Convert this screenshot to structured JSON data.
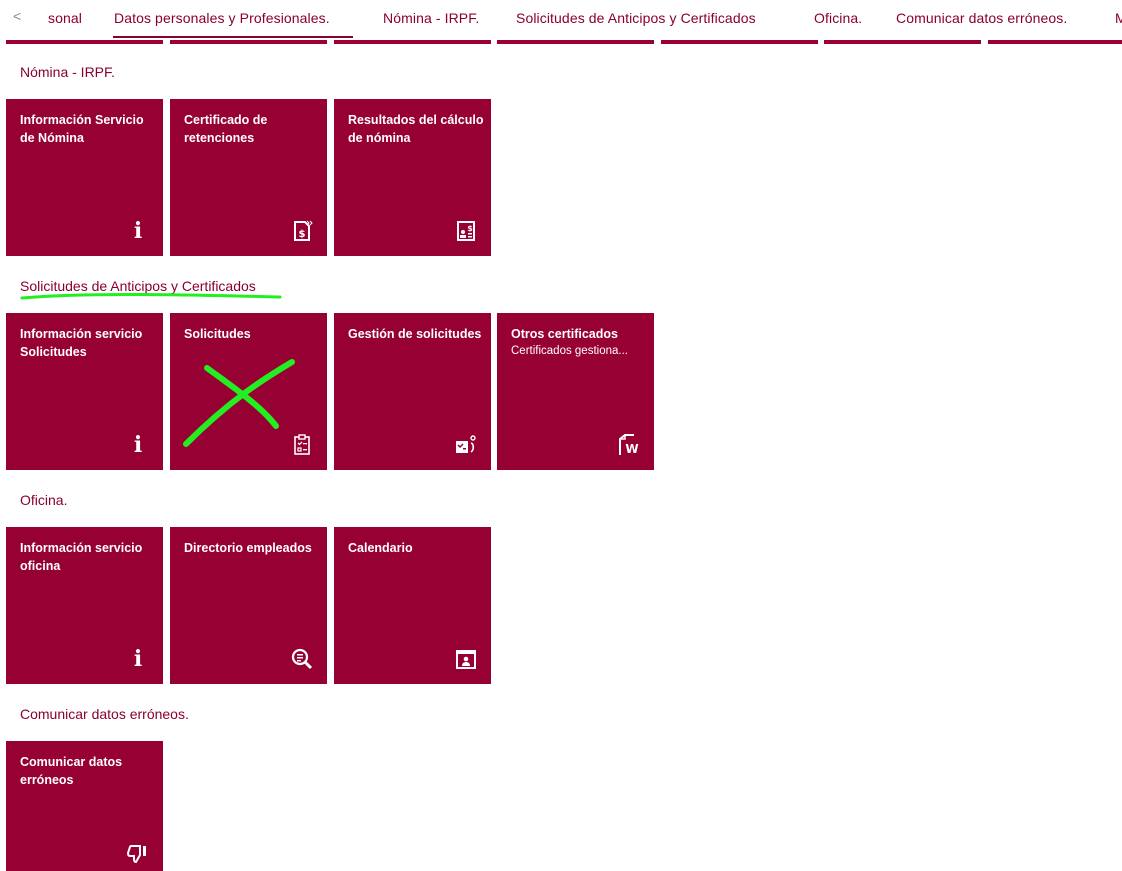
{
  "tabs": {
    "back_arrow": "<",
    "items": [
      {
        "label": "sonal"
      },
      {
        "label": "Datos personales y Profesionales."
      },
      {
        "label": "Nómina - IRPF."
      },
      {
        "label": "Solicitudes de Anticipos y Certificados"
      },
      {
        "label": "Oficina."
      },
      {
        "label": "Comunicar datos erróneos."
      },
      {
        "label": "M"
      }
    ]
  },
  "sections": {
    "nomina": {
      "title": "Nómina - IRPF.",
      "tiles": [
        {
          "title": "Información Servicio de Nómina",
          "icon": "info-icon"
        },
        {
          "title": "Certificado de retenciones",
          "icon": "document-money-icon"
        },
        {
          "title": "Resultados del cálculo de nómina",
          "icon": "payslip-icon"
        }
      ]
    },
    "solicitudes": {
      "title": "Solicitudes de Anticipos y Certificados",
      "tiles": [
        {
          "title": "Información servicio Solicitudes",
          "icon": "info-icon"
        },
        {
          "title": "Solicitudes",
          "icon": "clipboard-checklist-icon"
        },
        {
          "title": "Gestión de solicitudes",
          "icon": "request-management-icon"
        },
        {
          "title": "Otros certificados",
          "subtitle": "Certificados gestiona...",
          "icon": "word-document-icon"
        }
      ]
    },
    "oficina": {
      "title": "Oficina.",
      "tiles": [
        {
          "title": "Información servicio oficina",
          "icon": "info-icon"
        },
        {
          "title": "Directorio empleados",
          "icon": "search-list-icon"
        },
        {
          "title": "Calendario",
          "icon": "calendar-person-icon"
        }
      ]
    },
    "comunicar": {
      "title": "Comunicar datos erróneos.",
      "tiles": [
        {
          "title": "Comunicar datos erróneos",
          "icon": "thumbs-down-icon"
        }
      ]
    }
  },
  "colors": {
    "tile_background": "#970033",
    "accent_text": "#8a0030",
    "annotation": "#22ee22"
  }
}
